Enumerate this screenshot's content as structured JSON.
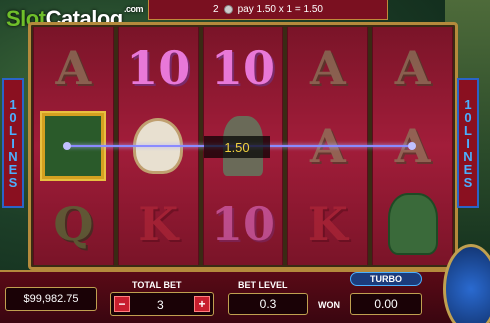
{
  "logo": {
    "part1": "Slot",
    "part2": "Catalog",
    "sup": ".com"
  },
  "win_info": {
    "count": "2",
    "text": "pay 1.50 x 1 = 1.50"
  },
  "lines_label": [
    "1",
    "0",
    "",
    "L",
    "I",
    "N",
    "E",
    "S"
  ],
  "reels": [
    [
      "A",
      "book",
      "Q"
    ],
    [
      "10",
      "mask",
      "K"
    ],
    [
      "10",
      "idol",
      "10"
    ],
    [
      "A",
      "A",
      "K"
    ],
    [
      "A",
      "A",
      "head"
    ]
  ],
  "win_amount": "1.50",
  "balance": "$99,982.75",
  "total_bet": {
    "label": "TOTAL BET",
    "value": "3",
    "minus": "−",
    "plus": "+"
  },
  "bet_level": {
    "label": "BET LEVEL",
    "value": "0.3"
  },
  "won": {
    "label": "WON",
    "value": "0.00"
  },
  "turbo_label": "TURBO"
}
